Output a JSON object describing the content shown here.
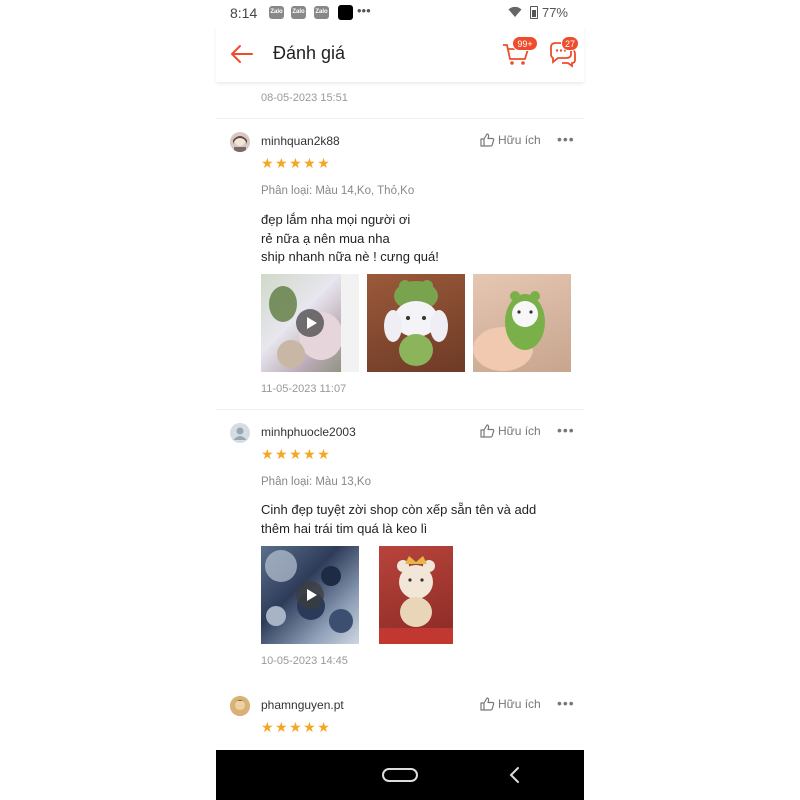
{
  "status_bar": {
    "time": "8:14",
    "apps": [
      "Zalo",
      "Zalo",
      "Zalo"
    ],
    "more": "•••",
    "battery": "77%"
  },
  "header": {
    "title": "Đánh giá",
    "cart_badge": "99+",
    "chat_badge": "27",
    "accent_color": "#ee4d2d"
  },
  "previous_review_date": "08-05-2023 15:51",
  "reviews": [
    {
      "username": "minhquan2k88",
      "helpful_label": "Hữu ích",
      "stars": "★★★★★",
      "rating": 5,
      "variant": "Phân loại: Màu 14,Ko, Thỏ,Ko",
      "lines": [
        "đẹp lắm nha mọi người ơi",
        "rẻ nữa ạ nên mua nha",
        "ship nhanh nữa nè ! cưng quá!"
      ],
      "date": "11-05-2023 11:07"
    },
    {
      "username": "minhphuocle2003",
      "helpful_label": "Hữu ích",
      "stars": "★★★★★",
      "rating": 5,
      "variant": "Phân loại: Màu 13,Ko",
      "lines": [
        "Cinh đẹp tuyệt zời shop còn xếp sẵn tên và add",
        "thêm hai trái tim quá là keo lì"
      ],
      "date": "10-05-2023 14:45"
    },
    {
      "username": "phamnguyen.pt",
      "helpful_label": "Hữu ích",
      "stars": "★★★★★",
      "rating": 5
    }
  ],
  "more_icon": "•••"
}
